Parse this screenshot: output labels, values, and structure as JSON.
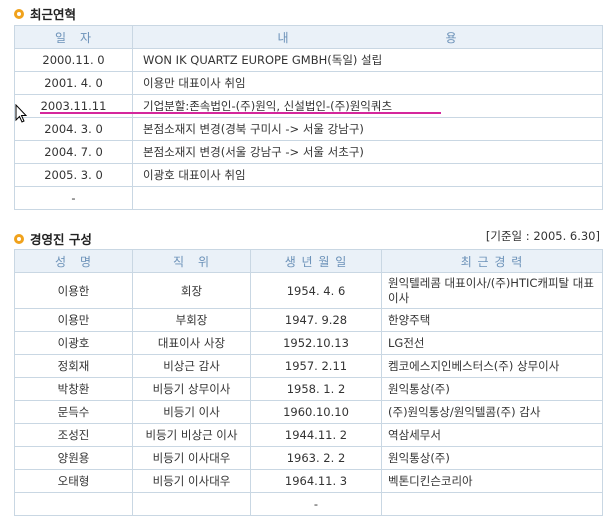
{
  "history": {
    "title": "최근연혁",
    "headers": [
      "일　자",
      "내　　　　　　　　　　　　용"
    ],
    "rows": [
      {
        "date": "2000.11. 0",
        "content": "WON IK QUARTZ EUROPE GMBH(독일) 설립"
      },
      {
        "date": "2001. 4. 0",
        "content": "이용만 대표이사 취임"
      },
      {
        "date": "2003.11.11",
        "content": "기업분할:존속법인-(주)원익, 신설법인-(주)원익쿼츠"
      },
      {
        "date": "2004. 3. 0",
        "content": "본점소재지 변경(경북 구미시 -> 서울 강남구)"
      },
      {
        "date": "2004. 7. 0",
        "content": "본점소재지 변경(서울 강남구 -> 서울 서초구)"
      },
      {
        "date": "2005. 3. 0",
        "content": "이광호 대표이사 취임"
      },
      {
        "date": "-",
        "content": ""
      }
    ]
  },
  "management": {
    "title": "경영진 구성",
    "reference_date": "[기준일 : 2005. 6.30]",
    "headers": [
      "성　명",
      "직　위",
      "생 년 월 일",
      "최 근 경 력"
    ],
    "rows": [
      {
        "name": "이용한",
        "position": "회장",
        "birth": "1954. 4. 6",
        "career": "원익텔레콤 대표이사/(주)HTIC캐피탈 대표이사"
      },
      {
        "name": "이용만",
        "position": "부회장",
        "birth": "1947. 9.28",
        "career": "한양주택"
      },
      {
        "name": "이광호",
        "position": "대표이사 사장",
        "birth": "1952.10.13",
        "career": "LG전선"
      },
      {
        "name": "정회재",
        "position": "비상근 감사",
        "birth": "1957. 2.11",
        "career": "켐코에스지인베스터스(주) 상무이사"
      },
      {
        "name": "박창환",
        "position": "비등기 상무이사",
        "birth": "1958. 1. 2",
        "career": "원익통상(주)"
      },
      {
        "name": "문득수",
        "position": "비등기 이사",
        "birth": "1960.10.10",
        "career": "(주)원익통상/원익텔콤(주) 감사"
      },
      {
        "name": "조성진",
        "position": "비등기 비상근 이사",
        "birth": "1944.11. 2",
        "career": "역삼세무서"
      },
      {
        "name": "양원용",
        "position": "비등기 이사대우",
        "birth": "1963. 2. 2",
        "career": "원익통상(주)"
      },
      {
        "name": "오태형",
        "position": "비등기 이사대우",
        "birth": "1964.11. 3",
        "career": "벡톤디킨슨코리아"
      },
      {
        "name": "",
        "position": "",
        "birth": "-",
        "career": ""
      }
    ]
  }
}
